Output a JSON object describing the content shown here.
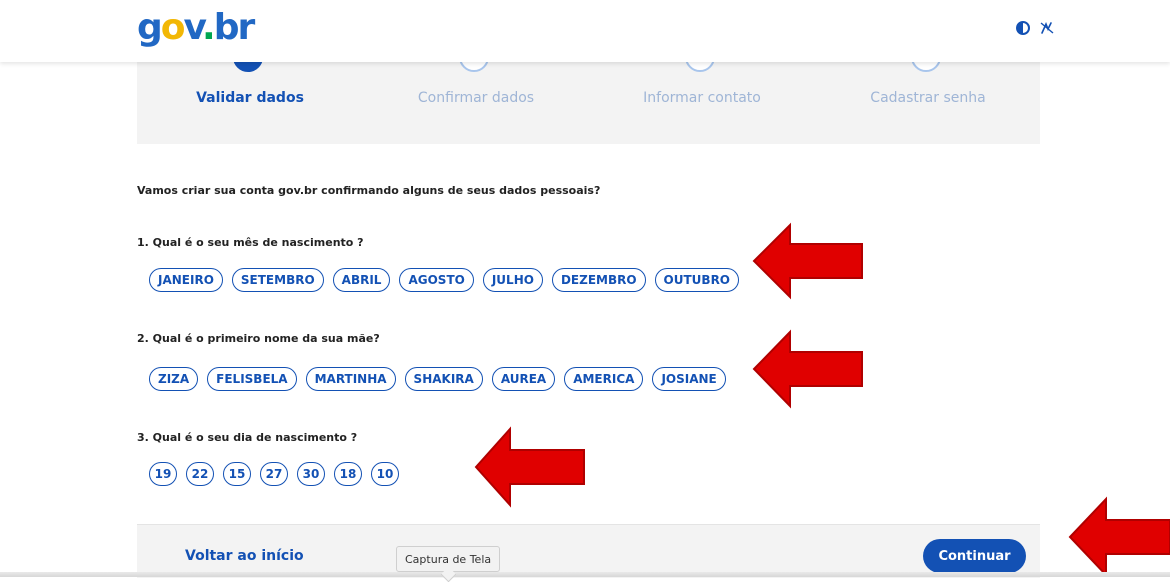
{
  "header": {
    "logo": {
      "g": "g",
      "o": "o",
      "v": "v",
      "dot": ".",
      "br": "br"
    },
    "icons": [
      "contrast-icon",
      "libras-accessibility-icon"
    ]
  },
  "stepper": {
    "steps": [
      {
        "label": "Validar dados",
        "active": true
      },
      {
        "label": "Confirmar dados",
        "active": false
      },
      {
        "label": "Informar contato",
        "active": false
      },
      {
        "label": "Cadastrar senha",
        "active": false
      }
    ]
  },
  "form": {
    "intro": "Vamos criar sua conta gov.br confirmando alguns de seus dados pessoais?",
    "questions": [
      {
        "label": "1. Qual é o seu mês de nascimento ?",
        "options": [
          "JANEIRO",
          "SETEMBRO",
          "ABRIL",
          "AGOSTO",
          "JULHO",
          "DEZEMBRO",
          "OUTUBRO"
        ]
      },
      {
        "label": "2. Qual é o primeiro nome da sua mãe?",
        "options": [
          "ZIZA",
          "FELISBELA",
          "MARTINHA",
          "SHAKIRA",
          "AUREA",
          "AMERICA",
          "JOSIANE"
        ]
      },
      {
        "label": "3. Qual é o seu dia de nascimento ?",
        "options": [
          "19",
          "22",
          "15",
          "27",
          "30",
          "18",
          "10"
        ]
      }
    ]
  },
  "footer": {
    "back_label": "Voltar ao início",
    "continue_label": "Continuar"
  },
  "tooltip": "Captura de Tela",
  "colors": {
    "primary": "#1351b4",
    "annotation_arrow": "#e00000"
  }
}
